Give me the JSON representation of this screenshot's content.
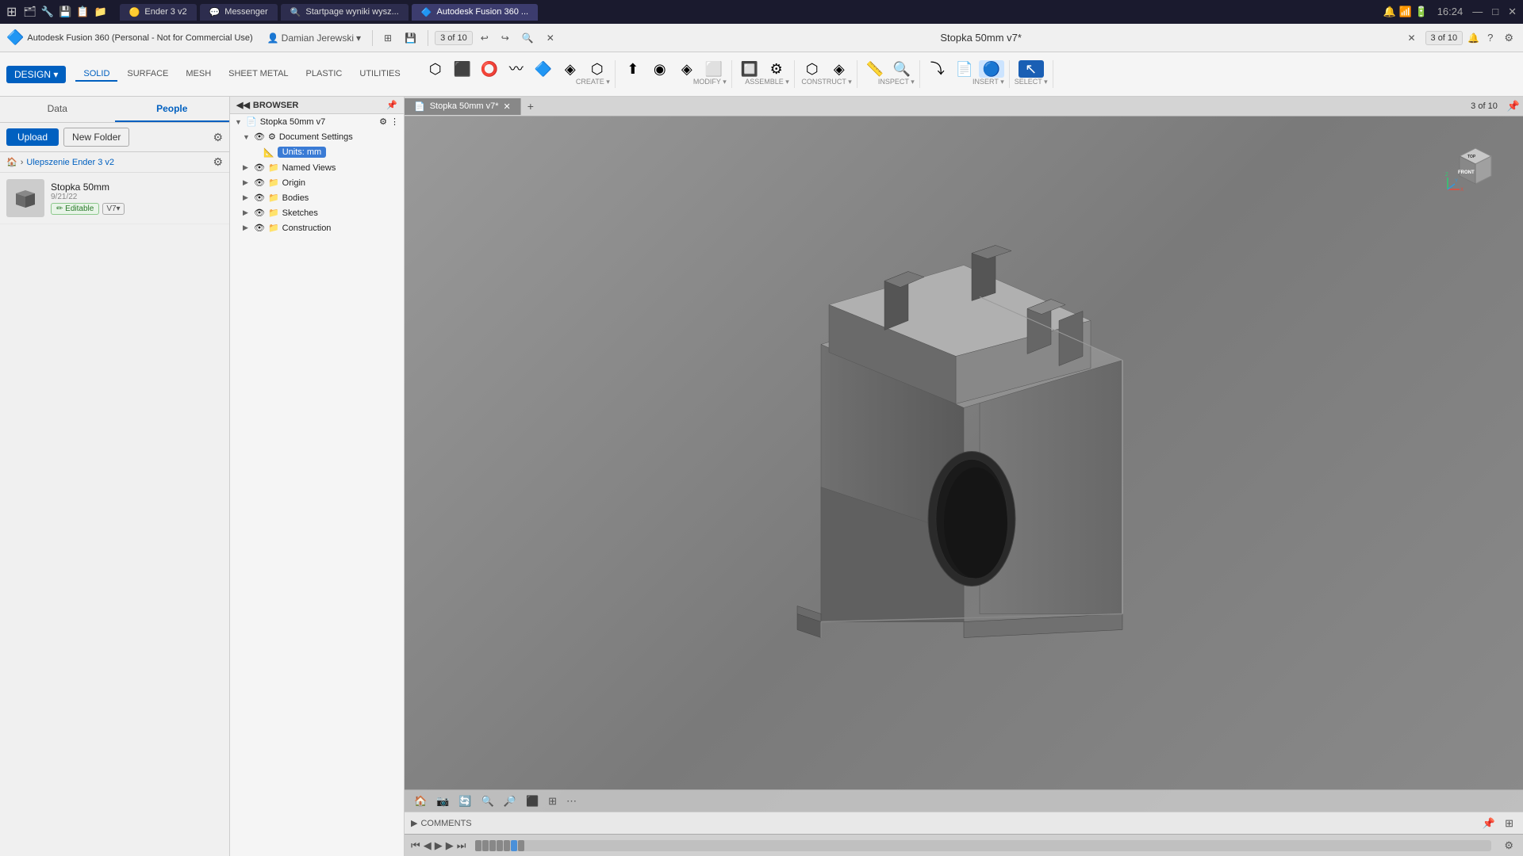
{
  "titlebar": {
    "tabs": [
      {
        "label": "Ender 3 v2",
        "active": false,
        "icon": "🟡"
      },
      {
        "label": "Messenger",
        "active": false,
        "icon": "💬"
      },
      {
        "label": "Startpage wyniki wysz...",
        "active": false,
        "icon": "🔍"
      },
      {
        "label": "Autodesk Fusion 360 ...",
        "active": true,
        "icon": "🔷"
      }
    ],
    "time": "16:24",
    "close": "✕",
    "minimize": "—",
    "maximize": "□"
  },
  "appbar": {
    "logo": "Autodesk Fusion 360 (Personal - Not for Commercial Use)",
    "user": "Damian Jerewski",
    "doc_count": "3 of 10",
    "doc_title": "Stopka 50mm v7*",
    "save_icon": "💾",
    "search_icon": "🔍",
    "close_icon": "✕",
    "grid_icon": "⊞",
    "undo_icon": "↩",
    "redo_icon": "↪",
    "count_label": "3 of 10",
    "bell_icon": "🔔",
    "help_icon": "?",
    "settings_icon": "⚙"
  },
  "toolbar": {
    "tabs": [
      {
        "label": "SOLID",
        "active": true
      },
      {
        "label": "SURFACE",
        "active": false
      },
      {
        "label": "MESH",
        "active": false
      },
      {
        "label": "SHEET METAL",
        "active": false
      },
      {
        "label": "PLASTIC",
        "active": false
      },
      {
        "label": "UTILITIES",
        "active": false
      }
    ],
    "design_btn": "DESIGN ▾",
    "groups": {
      "create": "CREATE ▾",
      "modify": "MODIFY ▾",
      "assemble": "ASSEMBLE ▾",
      "construct": "CONSTRUCT ▾",
      "inspect": "INSPECT ▾",
      "insert": "INSERT ▾",
      "select": "SELECT ▾"
    }
  },
  "left_panel": {
    "tabs": [
      {
        "label": "Data",
        "active": false
      },
      {
        "label": "People",
        "active": true
      }
    ],
    "upload_btn": "Upload",
    "new_folder_btn": "New Folder",
    "breadcrumb": "Ulepszenie Ender 3 v2",
    "files": [
      {
        "name": "Stopka 50mm",
        "date": "9/21/22",
        "tag": "Editable",
        "version": "V7▾"
      }
    ]
  },
  "browser": {
    "title": "BROWSER",
    "tree": [
      {
        "label": "Stopka 50mm v7",
        "level": 0,
        "arrow": "▼",
        "type": "file",
        "active": true
      },
      {
        "label": "Document Settings",
        "level": 1,
        "arrow": "▼",
        "type": "settings"
      },
      {
        "label": "Units: mm",
        "level": 2,
        "arrow": "",
        "type": "units",
        "highlight": true
      },
      {
        "label": "Named Views",
        "level": 1,
        "arrow": "▶",
        "type": "folder"
      },
      {
        "label": "Origin",
        "level": 1,
        "arrow": "▶",
        "type": "folder"
      },
      {
        "label": "Bodies",
        "level": 1,
        "arrow": "▶",
        "type": "folder"
      },
      {
        "label": "Sketches",
        "level": 1,
        "arrow": "▶",
        "type": "folder"
      },
      {
        "label": "Construction",
        "level": 1,
        "arrow": "▶",
        "type": "folder"
      }
    ]
  },
  "canvas": {
    "tab_label": "Stopka 50mm v7*",
    "tab_close": "✕",
    "tab_plus": "+",
    "count_label": "3 of 10",
    "pin_icon": "📌"
  },
  "comments": {
    "label": "COMMENTS",
    "pin_icon": "📌"
  },
  "timeline": {
    "rewind": "⏮",
    "prev": "◀",
    "play": "▶",
    "next": "▶",
    "end": "⏭"
  },
  "bottom_toolbar": {
    "icons": [
      "🏠",
      "🎥",
      "🖱",
      "🔍",
      "🔎",
      "⬛",
      "⬛",
      "⬛"
    ]
  },
  "navcube": {
    "label": "FRONT",
    "top_label": "TOP"
  }
}
